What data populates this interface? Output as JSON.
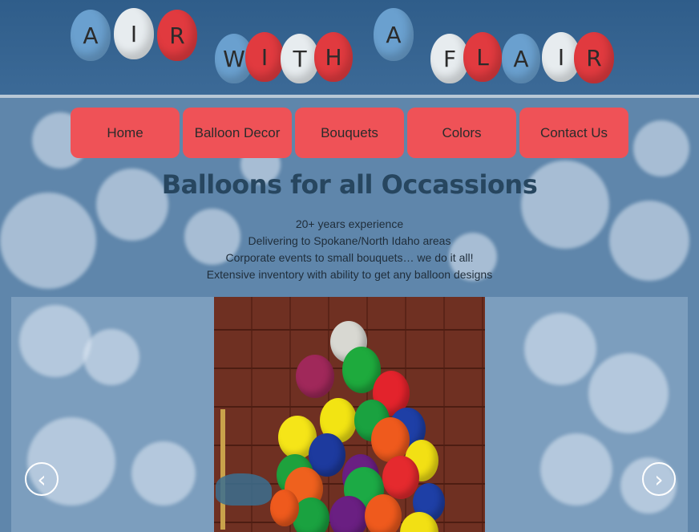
{
  "logo": {
    "text": "AIR WITH A FLAIR"
  },
  "nav": {
    "items": [
      {
        "label": "Home"
      },
      {
        "label": "Balloon Decor"
      },
      {
        "label": "Bouquets"
      },
      {
        "label": "Colors"
      },
      {
        "label": "Contact Us"
      }
    ]
  },
  "main": {
    "headline": "Balloons for all Occassions",
    "features": [
      "20+ years experience",
      "Delivering to Spokane/North Idaho areas",
      "Corporate events to small bouquets… we do it all!",
      "Extensive inventory with ability to get any balloon designs"
    ]
  },
  "slider": {
    "prev_icon": "chevron-left-icon",
    "next_icon": "chevron-right-icon",
    "prev_glyph": "‹",
    "next_glyph": "›"
  },
  "colors": {
    "button": "#ef5257",
    "header": "#2f5d8a"
  }
}
